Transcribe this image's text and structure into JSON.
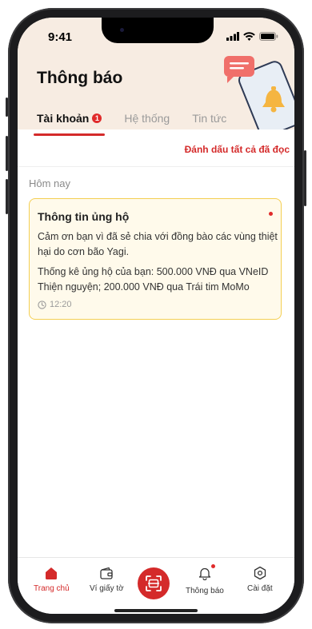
{
  "status_bar": {
    "time": "9:41"
  },
  "header": {
    "title": "Thông báo",
    "tabs": [
      {
        "label": "Tài khoản",
        "badge": "1"
      },
      {
        "label": "Hệ thống"
      },
      {
        "label": "Tin tức"
      }
    ]
  },
  "actions": {
    "mark_all_read": "Đánh dấu tất cả đã đọc"
  },
  "section": {
    "today": "Hôm nay"
  },
  "notification": {
    "title": "Thông tin ủng hộ",
    "paragraph1": "Cảm ơn bạn vì đã sẻ chia với đồng bào các vùng thiệt hại do cơn bão Yagi.",
    "paragraph2": "Thống kê ủng hộ của bạn: 500.000 VNĐ qua VNeID Thiện nguyện; 200.000 VNĐ qua Trái tim MoMo",
    "time": "12:20"
  },
  "bottom_nav": {
    "items": [
      {
        "label": "Trang chủ",
        "icon": "home-icon"
      },
      {
        "label": "Ví giấy tờ",
        "icon": "wallet-icon"
      },
      {
        "label": "",
        "icon": "scan-icon"
      },
      {
        "label": "Thông báo",
        "icon": "bell-icon"
      },
      {
        "label": "Cài đặt",
        "icon": "settings-icon"
      }
    ]
  },
  "colors": {
    "accent": "#d42a2a",
    "header_bg": "#f7ece2",
    "card_border": "#f4cf52",
    "card_bg": "#fffaeb"
  }
}
